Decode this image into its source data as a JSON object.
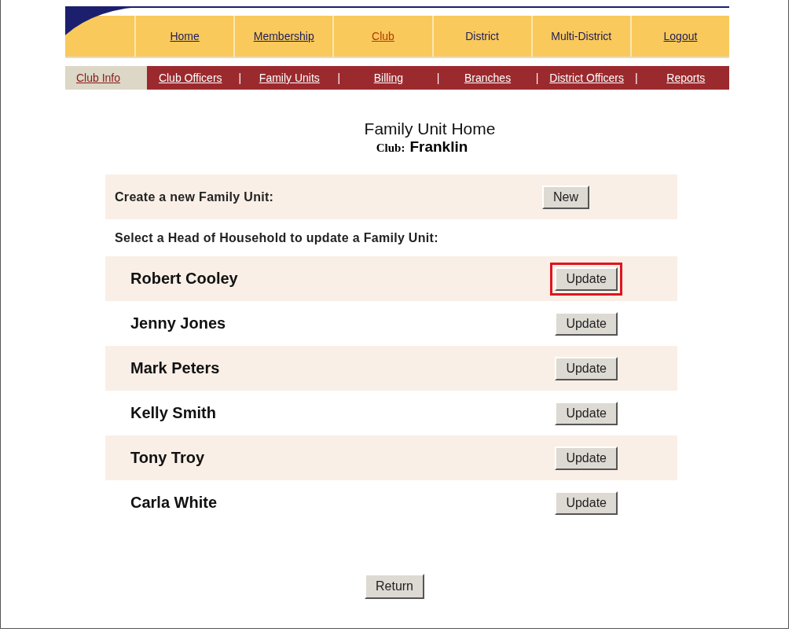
{
  "main_nav": [
    {
      "label": "Home",
      "selected": false,
      "linked": true
    },
    {
      "label": "Membership",
      "selected": false,
      "linked": true
    },
    {
      "label": "Club",
      "selected": true,
      "linked": true
    },
    {
      "label": "District",
      "selected": false,
      "linked": false
    },
    {
      "label": "Multi-District",
      "selected": false,
      "linked": false
    },
    {
      "label": "Logout",
      "selected": false,
      "linked": true
    }
  ],
  "sub_nav": [
    {
      "kind": "tab",
      "label": "Club Info",
      "selected": true
    },
    {
      "kind": "tab",
      "label": "Club Officers",
      "selected": false
    },
    {
      "kind": "separator",
      "label": "|"
    },
    {
      "kind": "tab",
      "label": "Family Units",
      "selected": false
    },
    {
      "kind": "separator",
      "label": "|"
    },
    {
      "kind": "tab",
      "label": "Billing",
      "selected": false
    },
    {
      "kind": "separator",
      "label": "|"
    },
    {
      "kind": "tab",
      "label": "Branches",
      "selected": false
    },
    {
      "kind": "separator",
      "label": "|"
    },
    {
      "kind": "tab",
      "label": "District Officers",
      "selected": false
    },
    {
      "kind": "separator",
      "label": "|"
    },
    {
      "kind": "tab",
      "label": "Reports",
      "selected": false
    }
  ],
  "title": "Family Unit Home",
  "club": {
    "label": "Club:",
    "value": "Franklin"
  },
  "create": {
    "label": "Create a new Family Unit:",
    "button": "New"
  },
  "select_label": "Select a Head of Household to update a Family Unit:",
  "households": [
    {
      "name": "Robert Cooley",
      "button": "Update",
      "shaded": true,
      "highlighted": true
    },
    {
      "name": "Jenny Jones",
      "button": "Update",
      "shaded": false,
      "highlighted": false
    },
    {
      "name": "Mark Peters",
      "button": "Update",
      "shaded": true,
      "highlighted": false
    },
    {
      "name": "Kelly Smith",
      "button": "Update",
      "shaded": false,
      "highlighted": false
    },
    {
      "name": "Tony Troy",
      "button": "Update",
      "shaded": true,
      "highlighted": false
    },
    {
      "name": "Carla White",
      "button": "Update",
      "shaded": false,
      "highlighted": false
    }
  ],
  "return_button": "Return"
}
